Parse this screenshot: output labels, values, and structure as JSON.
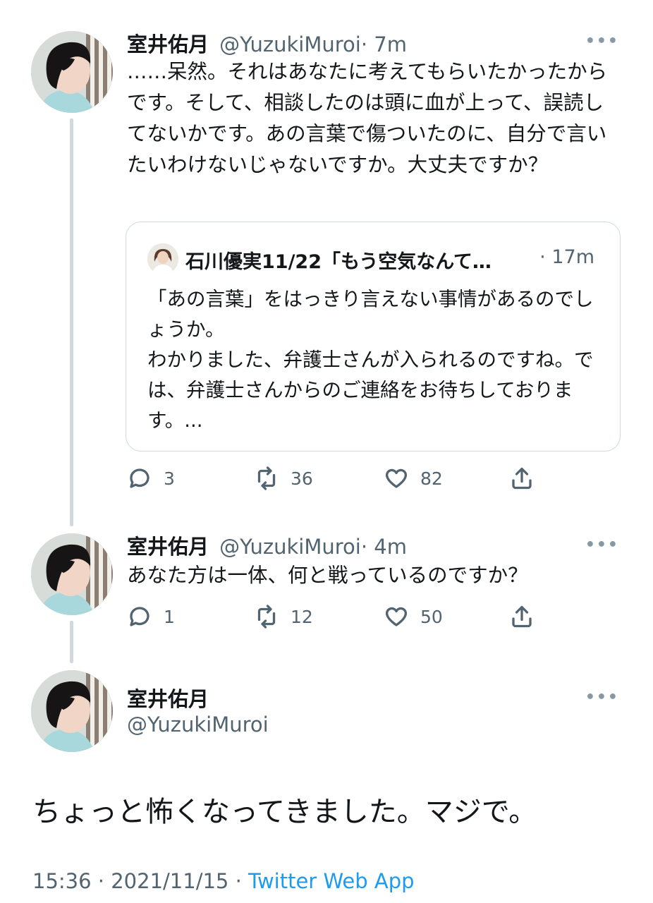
{
  "tweet1": {
    "name": "室井佑月",
    "handle": "@YuzukiMuroi",
    "time": "· 7m",
    "text": "……呆然。それはあなたに考えてもらいたかったからです。そして、相談したのは頭に血が上って、誤読してないかです。あの言葉で傷ついたのに、自分で言いたいわけないじゃないですか。大丈夫ですか？",
    "quote": {
      "name": "石川優実11/22「もう空気なんて…",
      "time": "· 17m",
      "text": "「あの言葉」をはっきり言えない事情があるのでしょうか。\nわかりました、弁護士さんが入られるのですね。では、弁護士さんからのご連絡をお待ちしております。..."
    },
    "replies": "3",
    "retweets": "36",
    "likes": "82"
  },
  "tweet2": {
    "name": "室井佑月",
    "handle": "@YuzukiMuroi",
    "time": "· 4m",
    "text": "あなた方は一体、何と戦っているのですか？",
    "replies": "1",
    "retweets": "12",
    "likes": "50"
  },
  "main_tweet": {
    "name": "室井佑月",
    "handle": "@YuzukiMuroi",
    "text": "ちょっと怖くなってきました。マジで。",
    "time": "15:36 · 2021/11/15 · ",
    "app": "Twitter Web App"
  },
  "icons": {
    "more": "more-dots-icon",
    "reply": "reply-icon",
    "retweet": "retweet-icon",
    "like": "heart-icon",
    "share": "share-icon"
  },
  "colors": {
    "text": "#14171a",
    "secondary": "#536471",
    "link": "#1d9bf0",
    "border": "#cfd9de"
  }
}
